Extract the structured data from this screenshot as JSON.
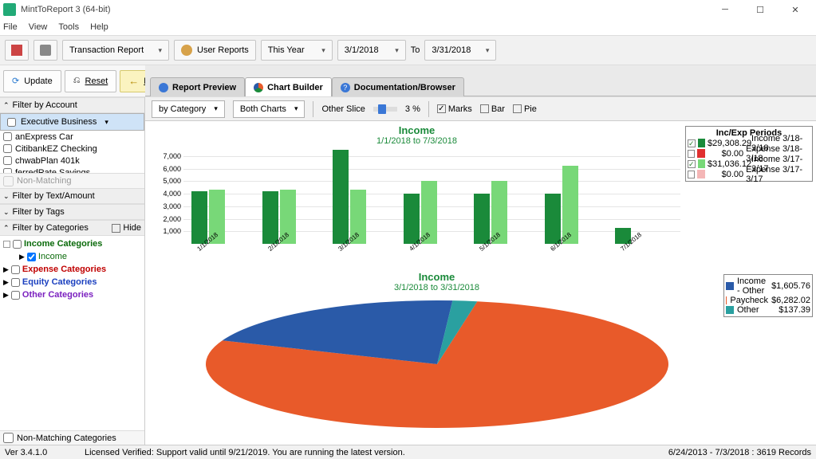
{
  "title": "MintToReport 3 (64-bit)",
  "menubar": [
    "File",
    "View",
    "Tools",
    "Help"
  ],
  "toolbar1": {
    "report_type": "Transaction Report",
    "user_reports": "User Reports",
    "period": "This Year",
    "date_from": "3/1/2018",
    "to_label": "To",
    "date_to": "3/31/2018"
  },
  "actions": {
    "update": "Update",
    "reset": "Reset",
    "back": "Back"
  },
  "tabs": [
    {
      "label": "Report Preview",
      "active": false
    },
    {
      "label": "Chart Builder",
      "active": true
    },
    {
      "label": "Documentation/Browser",
      "active": false
    }
  ],
  "sidebar": {
    "filter_account": "Filter by Account",
    "accounts": [
      "Executive Business",
      "anExpress Car",
      "CitibankEZ Checking",
      "chwabPlan 401k",
      "ferredRate Savings"
    ],
    "non_matching": "Non-Matching",
    "filter_text": "Filter by Text/Amount",
    "filter_tags": "Filter by Tags",
    "filter_cats": "Filter by Categories",
    "hide": "Hide",
    "cats": {
      "income": "Income Categories",
      "income_sub": "Income",
      "expense": "Expense Categories",
      "equity": "Equity Categories",
      "other": "Other Categories"
    },
    "non_matching_cats": "Non-Matching Categories"
  },
  "charttools": {
    "by": "by Category",
    "mode": "Both Charts",
    "other_slice": "Other Slice",
    "pct": "3 %",
    "marks": "Marks",
    "bar": "Bar",
    "pie": "Pie"
  },
  "bar_legend_title": "Inc/Exp Periods",
  "bar_legend": [
    {
      "amount": "$29,308.29",
      "label": "Income 3/18-3/18",
      "color": "#1a8a3a",
      "checked": true
    },
    {
      "amount": "$0.00",
      "label": "Expense 3/18-3/18",
      "color": "#e03030",
      "checked": false
    },
    {
      "amount": "$31,036.12",
      "label": "Income 3/17-3/17",
      "color": "#78d878",
      "checked": true
    },
    {
      "amount": "$0.00",
      "label": "Expense 3/17-3/17",
      "color": "#f4b6b6",
      "checked": false
    }
  ],
  "pie_legend": [
    {
      "name": "Income - Other",
      "amount": "$1,605.76",
      "color": "#2a5aa8"
    },
    {
      "name": "Paycheck",
      "amount": "$6,282.02",
      "color": "#e85a2a"
    },
    {
      "name": "Other",
      "amount": "$137.39",
      "color": "#2aa0a0"
    }
  ],
  "chart_data": [
    {
      "type": "bar",
      "title": "Income",
      "subtitle": "1/1/2018 to 7/3/2018",
      "categories": [
        "1/1/2018",
        "2/1/2018",
        "3/1/2018",
        "4/1/2018",
        "5/1/2018",
        "6/1/2018",
        "7/1/2018"
      ],
      "series": [
        {
          "name": "Income 3/18-3/18",
          "color": "#1a8a3a",
          "values": [
            4200,
            4200,
            7500,
            4000,
            4000,
            4000,
            1300
          ]
        },
        {
          "name": "Income 3/17-3/17",
          "color": "#78d878",
          "values": [
            4300,
            4300,
            4300,
            5000,
            5000,
            6200,
            0
          ]
        }
      ],
      "ylim": [
        0,
        7500
      ],
      "yticks": [
        1000,
        2000,
        3000,
        4000,
        5000,
        6000,
        7000
      ],
      "xlabel": "",
      "ylabel": ""
    },
    {
      "type": "pie",
      "title": "Income",
      "subtitle": "3/1/2018 to 3/31/2018",
      "slices": [
        {
          "name": "Paycheck",
          "value": 6282.02,
          "color": "#e85a2a"
        },
        {
          "name": "Income - Other",
          "value": 1605.76,
          "color": "#2a5aa8"
        },
        {
          "name": "Other",
          "value": 137.39,
          "color": "#2aa0a0"
        }
      ]
    }
  ],
  "statusbar": {
    "version": "Ver 3.4.1.0",
    "license": "Licensed Verified: Support valid until 9/21/2019. You are running the latest version.",
    "range": "6/24/2013 - 7/3/2018 : 3619 Records"
  }
}
